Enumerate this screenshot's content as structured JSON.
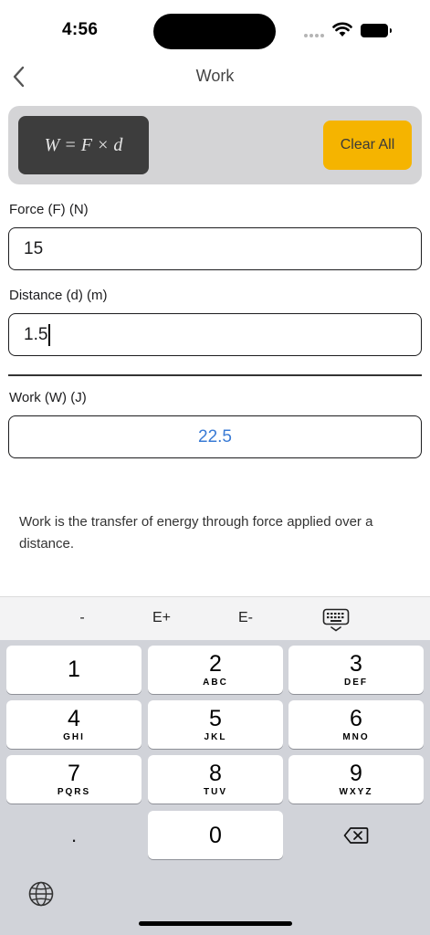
{
  "status_bar": {
    "time": "4:56"
  },
  "nav": {
    "title": "Work"
  },
  "formula": {
    "text": "W = F × d",
    "clear_label": "Clear All"
  },
  "inputs": {
    "force": {
      "label": "Force (F) (N)",
      "value": "15"
    },
    "distance": {
      "label": "Distance (d) (m)",
      "value": "1.5"
    }
  },
  "result": {
    "label": "Work (W) (J)",
    "value": "22.5"
  },
  "description": "Work is the transfer of energy through force applied over a distance.",
  "accessory": {
    "minus": "-",
    "eplus": "E+",
    "eminus": "E-"
  },
  "keypad": {
    "k1": {
      "num": "1",
      "sub": ""
    },
    "k2": {
      "num": "2",
      "sub": "ABC"
    },
    "k3": {
      "num": "3",
      "sub": "DEF"
    },
    "k4": {
      "num": "4",
      "sub": "GHI"
    },
    "k5": {
      "num": "5",
      "sub": "JKL"
    },
    "k6": {
      "num": "6",
      "sub": "MNO"
    },
    "k7": {
      "num": "7",
      "sub": "PQRS"
    },
    "k8": {
      "num": "8",
      "sub": "TUV"
    },
    "k9": {
      "num": "9",
      "sub": "WXYZ"
    },
    "k0": {
      "num": "0"
    },
    "dot": "."
  },
  "colors": {
    "accent": "#f5b400",
    "result": "#3a7bd5",
    "formula_bg": "#3d3d3d"
  }
}
